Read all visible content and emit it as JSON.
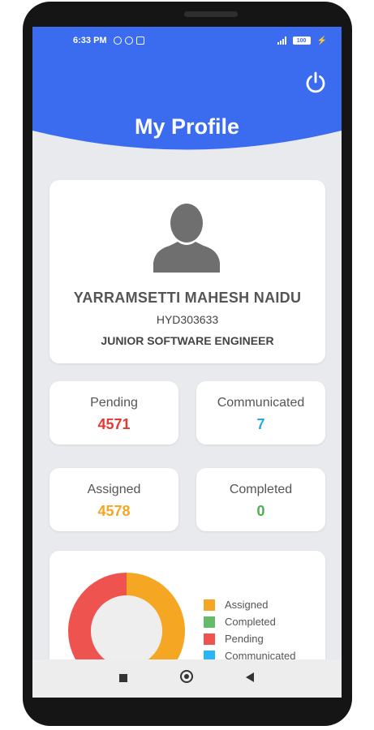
{
  "status_bar": {
    "time": "6:33 PM",
    "battery": "100"
  },
  "header": {
    "title": "My Profile"
  },
  "profile": {
    "name": "YARRAMSETTI MAHESH NAIDU",
    "employee_id": "HYD303633",
    "role": "JUNIOR SOFTWARE ENGINEER"
  },
  "stats": {
    "pending": {
      "label": "Pending",
      "value": "4571",
      "color": "#e53935"
    },
    "communicated": {
      "label": "Communicated",
      "value": "7",
      "color": "#29a8e0"
    },
    "assigned": {
      "label": "Assigned",
      "value": "4578",
      "color": "#f5a623"
    },
    "completed": {
      "label": "Completed",
      "value": "0",
      "color": "#4caf50"
    }
  },
  "chart_data": {
    "type": "pie",
    "categories": [
      "Assigned",
      "Completed",
      "Pending",
      "Communicated"
    ],
    "values": [
      4578,
      0,
      4571,
      7
    ],
    "colors": [
      "#f5a623",
      "#66bb6a",
      "#ef5350",
      "#29b6f6"
    ]
  },
  "legend": {
    "items": [
      {
        "label": "Assigned",
        "color": "#f5a623"
      },
      {
        "label": "Completed",
        "color": "#66bb6a"
      },
      {
        "label": "Pending",
        "color": "#ef5350"
      },
      {
        "label": "Communicated",
        "color": "#29b6f6"
      }
    ]
  },
  "colors": {
    "header": "#3b6cf0",
    "background": "#e8eaed"
  },
  "icons": {
    "power": "power-icon",
    "avatar": "person-silhouette-icon"
  }
}
